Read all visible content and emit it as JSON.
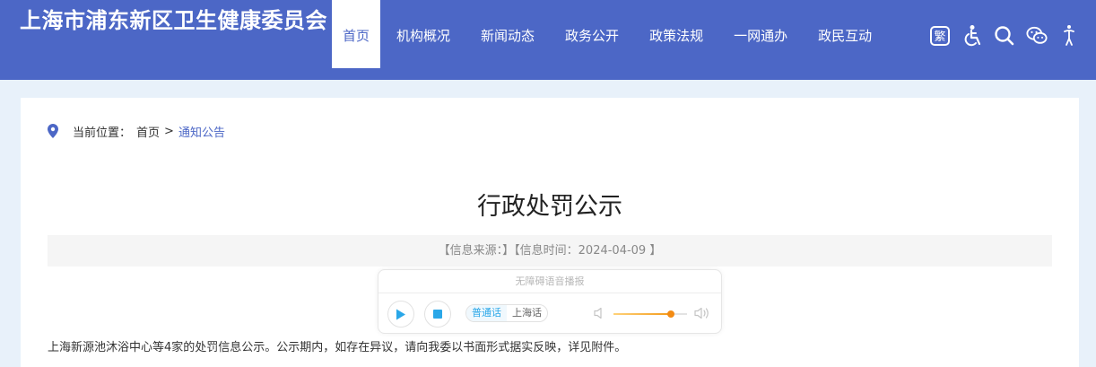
{
  "header": {
    "site_title": "上海市浦东新区卫生健康委员会",
    "nav": [
      {
        "label": "首页",
        "active": true
      },
      {
        "label": "机构概况",
        "active": false
      },
      {
        "label": "新闻动态",
        "active": false
      },
      {
        "label": "政务公开",
        "active": false
      },
      {
        "label": "政策法规",
        "active": false
      },
      {
        "label": "一网通办",
        "active": false
      },
      {
        "label": "政民互动",
        "active": false
      }
    ],
    "tools": [
      {
        "icon": "traditional-chinese-icon",
        "glyph": "繁"
      },
      {
        "icon": "accessibility-icon"
      },
      {
        "icon": "search-icon"
      },
      {
        "icon": "wechat-icon"
      },
      {
        "icon": "elderly-mode-icon"
      }
    ]
  },
  "breadcrumb": {
    "icon": "location-pin-icon",
    "label": "当前位置：",
    "home": "首页",
    "separator": ">",
    "current": "通知公告"
  },
  "article": {
    "title": "行政处罚公示",
    "meta": "【信息来源：】【信息时间：2024-04-09 】",
    "content": "上海新源池沐浴中心等4家的处罚信息公示。公示期内，如存在异议，请向我委以书面形式据实反映，详见附件。"
  },
  "player": {
    "title": "无障碍语音播报",
    "languages": [
      {
        "label": "普通话",
        "selected": true
      },
      {
        "label": "上海话",
        "selected": false
      }
    ],
    "volume": 0.78
  },
  "colors": {
    "header_bg": "#4c67c6",
    "page_bg": "#e8f1fa",
    "accent": "#2aa7e8",
    "slider": "#f38b14"
  }
}
